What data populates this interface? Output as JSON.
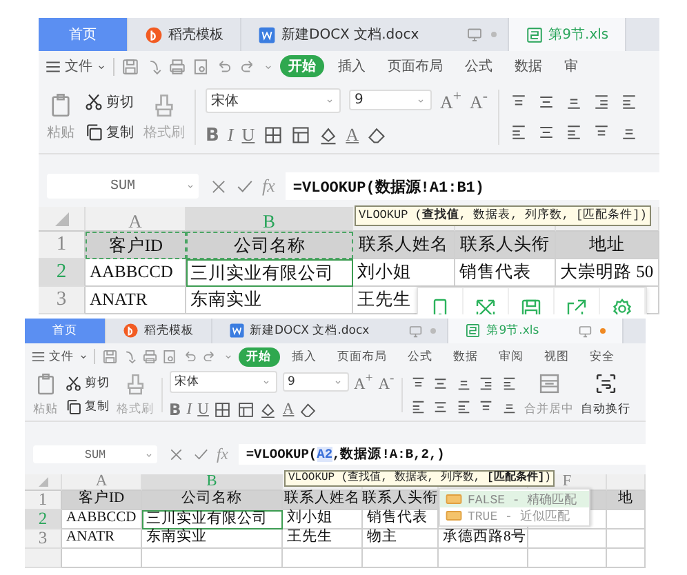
{
  "screens": [
    {
      "tabs": [
        {
          "label": "首页",
          "kind": "home",
          "selected": false,
          "controls": false
        },
        {
          "label": "稻壳模板",
          "kind": "docer",
          "selected": false,
          "controls": false
        },
        {
          "label": "新建DOCX 文档.docx",
          "kind": "word",
          "selected": false,
          "controls": true
        },
        {
          "label": "第9节.xls",
          "kind": "sheet",
          "selected": true,
          "controls": false
        }
      ],
      "file_menu": "文件",
      "menu": [
        {
          "label": "开始",
          "selected": true
        },
        {
          "label": "插入",
          "selected": false
        },
        {
          "label": "页面布局",
          "selected": false
        },
        {
          "label": "公式",
          "selected": false
        },
        {
          "label": "数据",
          "selected": false
        },
        {
          "label": "审",
          "selected": false
        }
      ],
      "ribbon": {
        "paste": "粘贴",
        "cut": "剪切",
        "copy": "复制",
        "format_painter": "格式刷",
        "font": "宋体",
        "font_size": "9",
        "grow": "A$^{+}$",
        "shrink": "A$^{-}$",
        "bold": "B",
        "italic": "I",
        "underline": "U",
        "font_color": "A"
      },
      "formula_bar": {
        "name_box": "SUM",
        "fx": "fx",
        "formula": [
          {
            "kind": "plain",
            "text": "=VLOOKUP(数据源!A1:B1)"
          }
        ]
      },
      "tooltip": "VLOOKUP (**查找值**, 数据表, 列序数, [匹配条件])",
      "grid": {
        "columns": [
          {
            "letter": "A",
            "selected": false
          },
          {
            "letter": "B",
            "selected": true
          },
          {
            "selected": false
          },
          {
            "selected": false
          },
          {
            "selected": false
          }
        ],
        "rows": [
          {
            "number": "1",
            "kind": "header",
            "selected": false,
            "cells": [
              {
                "text": "客户ID",
                "marquee": true
              },
              {
                "text": "公司名称",
                "marquee": true
              },
              {
                "text": "联系人姓名",
                "marquee": false
              },
              {
                "text": "联系人头衔",
                "marquee": false
              },
              {
                "text": "地址",
                "marquee": false
              }
            ]
          },
          {
            "number": "2",
            "kind": "data",
            "selected": true,
            "cells": [
              {
                "text": "AABBCCD",
                "marquee": false
              },
              {
                "text": "三川实业有限公司",
                "marquee": false
              },
              {
                "text": "刘小姐",
                "marquee": false
              },
              {
                "text": "销售代表",
                "marquee": false
              },
              {
                "text": "大崇明路 50",
                "marquee": false
              }
            ]
          },
          {
            "number": "3",
            "kind": "data",
            "selected": false,
            "cells": [
              {
                "text": "ANATR",
                "marquee": false
              },
              {
                "text": "东南实业",
                "marquee": false
              },
              {
                "text": "王先生",
                "marquee": false
              }
            ]
          }
        ]
      },
      "float_toolbar": true
    },
    {
      "tabs": [
        {
          "label": "首页",
          "kind": "home",
          "selected": false,
          "controls": false
        },
        {
          "label": "稻壳模板",
          "kind": "docer",
          "selected": false,
          "controls": false
        },
        {
          "label": "新建DOCX 文档.docx",
          "kind": "word",
          "selected": false,
          "controls": true
        },
        {
          "label": "第9节.xls",
          "kind": "sheet",
          "selected": true,
          "controls": true
        }
      ],
      "file_menu": "文件",
      "menu": [
        {
          "label": "开始",
          "selected": true
        },
        {
          "label": "插入",
          "selected": false
        },
        {
          "label": "页面布局",
          "selected": false
        },
        {
          "label": "公式",
          "selected": false
        },
        {
          "label": "数据",
          "selected": false
        },
        {
          "label": "审阅",
          "selected": false
        },
        {
          "label": "视图",
          "selected": false
        },
        {
          "label": "安全",
          "selected": false
        }
      ],
      "ribbon": {
        "paste": "粘贴",
        "cut": "剪切",
        "copy": "复制",
        "format_painter": "格式刷",
        "font": "宋体",
        "font_size": "9",
        "grow": "A$^{+}$",
        "shrink": "A$^{-}$",
        "bold": "B",
        "italic": "I",
        "underline": "U",
        "font_color": "A",
        "merge": "合并居中",
        "wrap": "自动换行"
      },
      "formula_bar": {
        "name_box": "SUM",
        "fx": "fx",
        "formula": [
          {
            "kind": "plain",
            "text": "=VLOOKUP("
          },
          {
            "kind": "ref",
            "text": "A2"
          },
          {
            "kind": "plain",
            "text": ",数据源!A:B,2,)"
          }
        ]
      },
      "tooltip": "VLOOKUP (查找值, 数据表, 列序数, **[匹配条件]**)",
      "grid": {
        "columns": [
          {
            "letter": "A",
            "selected": false
          },
          {
            "letter": "B",
            "selected": true
          },
          {
            "selected": false
          },
          {
            "selected": false
          },
          {
            "selected": false
          },
          {
            "letter": "F",
            "selected": false
          },
          {
            "selected": false
          }
        ],
        "rows": [
          {
            "number": "1",
            "kind": "header",
            "selected": false,
            "cells": [
              "客户ID",
              "公司名称",
              "联系人姓名",
              "联系人头衔",
              null,
              null,
              "地"
            ]
          },
          {
            "number": "2",
            "kind": "data",
            "selected": true,
            "cells": [
              "AABBCCD",
              "三川实业有限公司",
              "刘小姐",
              "销售代表"
            ]
          },
          {
            "number": "3",
            "kind": "data",
            "selected": false,
            "cells": [
              "ANATR",
              "东南实业",
              "王先生",
              "物主",
              "承德西路8号"
            ]
          },
          {
            "kind": "data",
            "selected": false,
            "cells": []
          }
        ]
      },
      "autocomplete": [
        {
          "label": "FALSE - 精确匹配",
          "selected": true
        },
        {
          "label": "TRUE - 近似匹配",
          "selected": false
        }
      ]
    }
  ]
}
